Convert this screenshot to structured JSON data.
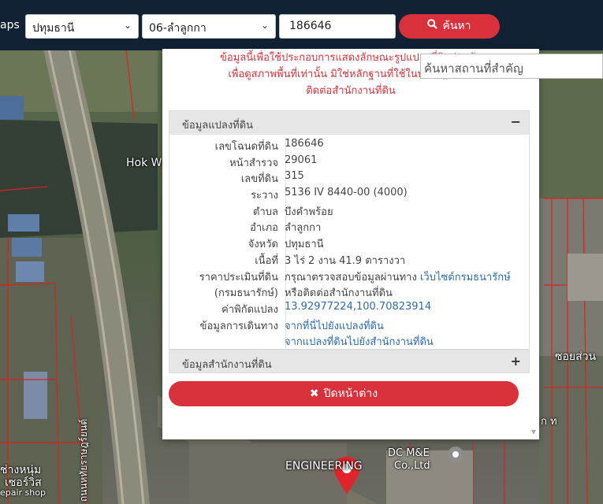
{
  "header": {
    "brand": "aps",
    "province": "ปทุมธานี",
    "district": "06-ลำลูกกา",
    "deed_number": "186646",
    "search_label": "ค้นหา",
    "search_icon": "search-icon"
  },
  "landmark_search": {
    "placeholder": "ค้นหาสถานที่สำคัญ"
  },
  "notice": {
    "line1": "ข้อมูลนี้เพื่อใช้ประกอบการแสดงลักษณะรูปแปลงที่ดินร่วมกับ",
    "line2": "เพื่อดูสภาพพื้นที่เท่านั้น มิใช่หลักฐานที่ใช้ในทางกฎหมาย",
    "line3": "ติดต่อสำนักงานที่ดิน"
  },
  "land_panel": {
    "title": "ข้อมูลแปลงที่ดิน",
    "toggle": "−",
    "rows": [
      {
        "label": "เลขโฉนดที่ดิน",
        "value": "186646"
      },
      {
        "label": "หน้าสำรวจ",
        "value": "29061"
      },
      {
        "label": "เลขที่ดิน",
        "value": "315"
      },
      {
        "label": "ระวาง",
        "value": "5136 IV 8440-00 (4000)"
      },
      {
        "label": "ตำบล",
        "value": "บึงคำพร้อย"
      },
      {
        "label": "อำเภอ",
        "value": "ลำลูกกา"
      },
      {
        "label": "จังหวัด",
        "value": "ปทุมธานี"
      },
      {
        "label": "เนื้อที่",
        "value": "3 ไร่ 2 งาน 41.9 ตารางวา"
      },
      {
        "label": "ราคาประเมินที่ดิน",
        "value": "กรุณาตรวจสอบข้อมูลผ่านทาง",
        "link": "เว็บไซต์กรมธนารักษ์"
      },
      {
        "label": "(กรมธนารักษ์)",
        "value": "หรือติดต่อสำนักงานที่ดิน"
      },
      {
        "label": "ค่าพิกัดแปลง",
        "value": "13.92977224,100.70823914"
      },
      {
        "label": "ข้อมูลการเดินทาง",
        "value": "จากที่นี่ไปยังแปลงที่ดิน"
      },
      {
        "label": "",
        "value": "จากแปลงที่ดินไปยังสำนักงานที่ดิน"
      }
    ]
  },
  "office_panel": {
    "title": "ข้อมูลสำนักงานที่ดิน",
    "toggle": "+"
  },
  "close_button": {
    "label": "ปิดหน้าต่าง",
    "icon": "close-icon"
  },
  "map_labels": {
    "hok": "Hok W",
    "road_vertical": "ถนนหทัยราษฎร์ยนต์",
    "soi": "ซอยส่วน",
    "shop1": "ช่างหนุ่ม",
    "shop2": "เซอร์วิส",
    "shop3": "epair shop",
    "dc": "DC M&E",
    "dc2": "Co.,Ltd",
    "eng": "ENGINEERING",
    "kt": "ก ท",
    "ki": "ก ท"
  },
  "colors": {
    "accent": "#d9313b",
    "topbar": "#0f2133",
    "link": "#2b6cb0"
  }
}
